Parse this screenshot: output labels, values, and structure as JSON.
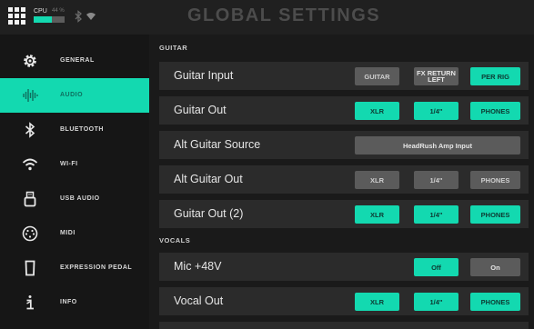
{
  "topbar": {
    "cpu_label": "CPU",
    "cpu_percent": "44 %",
    "cpu_level": 0.6,
    "title": "GLOBAL SETTINGS"
  },
  "colors": {
    "accent": "#13d9b0",
    "button_off": "#5b5b5b",
    "row_bg": "#2b2b2b"
  },
  "sidebar": {
    "items": [
      {
        "label": "GENERAL",
        "icon": "gear-icon",
        "active": false
      },
      {
        "label": "AUDIO",
        "icon": "audio-waveform-icon",
        "active": true
      },
      {
        "label": "BLUETOOTH",
        "icon": "bluetooth-icon",
        "active": false
      },
      {
        "label": "WI-FI",
        "icon": "wifi-icon",
        "active": false
      },
      {
        "label": "USB AUDIO",
        "icon": "usb-icon",
        "active": false
      },
      {
        "label": "MIDI",
        "icon": "midi-icon",
        "active": false
      },
      {
        "label": "EXPRESSION PEDAL",
        "icon": "expression-pedal-icon",
        "active": false
      },
      {
        "label": "INFO",
        "icon": "info-icon",
        "active": false
      }
    ]
  },
  "main": {
    "guitar_header": "GUITAR",
    "vocals_header": "VOCALS",
    "rows": {
      "guitar_input": {
        "label": "Guitar Input",
        "opt1": "GUITAR",
        "opt2a": "FX RETURN",
        "opt2b": "LEFT",
        "opt3": "PER RIG"
      },
      "guitar_out": {
        "label": "Guitar Out",
        "opt1": "XLR",
        "opt2": "1/4\"",
        "opt3": "PHONES"
      },
      "alt_source": {
        "label": "Alt Guitar Source",
        "value": "HeadRush Amp Input"
      },
      "alt_out": {
        "label": "Alt Guitar Out",
        "opt1": "XLR",
        "opt2": "1/4\"",
        "opt3": "PHONES"
      },
      "guitar_out2": {
        "label": "Guitar Out (2)",
        "opt1": "XLR",
        "opt2": "1/4\"",
        "opt3": "PHONES"
      },
      "mic48": {
        "label": "Mic +48V",
        "opt1": "Off",
        "opt2": "On"
      },
      "vocal_out": {
        "label": "Vocal Out",
        "opt1": "XLR",
        "opt2": "1/4\"",
        "opt3": "PHONES"
      }
    }
  }
}
